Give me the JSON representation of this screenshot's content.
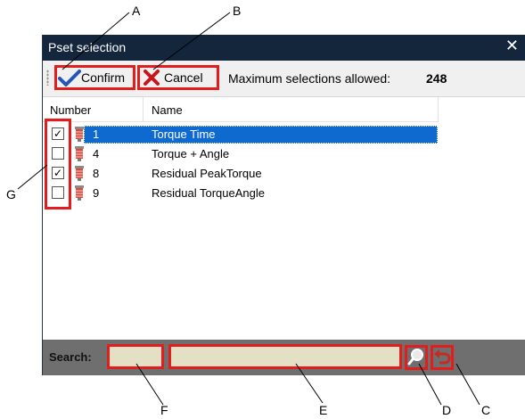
{
  "callouts": [
    "A",
    "B",
    "C",
    "D",
    "E",
    "F",
    "G"
  ],
  "window": {
    "title": "Pset selection",
    "close_glyph": "✕"
  },
  "toolbar": {
    "confirm_label": "Confirm",
    "cancel_label": "Cancel",
    "max_label": "Maximum selections allowed:",
    "max_value": "248"
  },
  "grid": {
    "columns": [
      "Number",
      "Name"
    ],
    "rows": [
      {
        "checked": true,
        "number": "1",
        "name": "Torque Time",
        "selected": true
      },
      {
        "checked": false,
        "number": "4",
        "name": "Torque + Angle",
        "selected": false
      },
      {
        "checked": true,
        "number": "8",
        "name": "Residual PeakTorque",
        "selected": false
      },
      {
        "checked": false,
        "number": "9",
        "name": "Residual TorqueAngle",
        "selected": false
      }
    ]
  },
  "search": {
    "label": "Search:",
    "number_value": "",
    "name_value": ""
  },
  "icons": {
    "confirm": "checkmark-icon",
    "cancel": "red-x-icon",
    "row": "tightening-tool-icon",
    "search": "magnifier-icon",
    "reset": "undo-arrow-icon"
  },
  "colors": {
    "titlebar": "#14263c",
    "selection": "#0f6ad0",
    "highlight": "#e21d1d",
    "searchbar": "#6f6f6f",
    "search_field": "#e4e0c6"
  }
}
